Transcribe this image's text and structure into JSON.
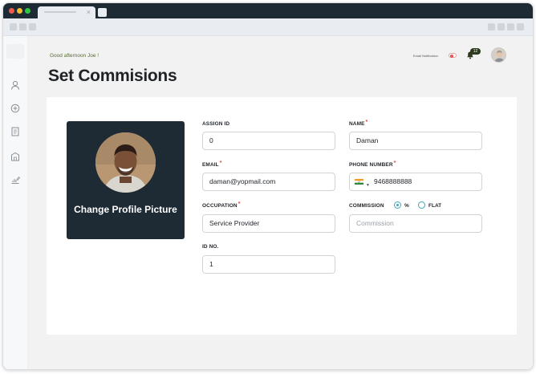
{
  "browser": {
    "tab_close": "×"
  },
  "header": {
    "greeting": "Good afternoon Joe !",
    "email_notification_label": "Email Notification",
    "notification_count": "12"
  },
  "page": {
    "title": "Set Commisions"
  },
  "profile": {
    "change_picture_label": "Change Profile Picture"
  },
  "form": {
    "assign_id": {
      "label": "ASSIGN ID",
      "value": "0"
    },
    "name": {
      "label": "NAME",
      "value": "Daman",
      "required": true
    },
    "email": {
      "label": "EMAIL",
      "value": "daman@yopmail.com",
      "required": true
    },
    "phone_number": {
      "label": "PHONE NUMBER",
      "value": "9468888888",
      "required": true,
      "country_flag": "india-flag-icon"
    },
    "occupation": {
      "label": "OCCUPATION",
      "value": "Service Provider",
      "required": true
    },
    "commission": {
      "label": "COMMISSION",
      "options": [
        "%",
        "FLAT"
      ],
      "selected": "%",
      "placeholder": "Commission"
    },
    "id_no": {
      "label": "ID NO.",
      "value": "1"
    }
  },
  "sidebar": {
    "icons": [
      "user-icon",
      "add-circle-icon",
      "document-list-icon",
      "building-icon",
      "chart-edit-icon"
    ]
  },
  "colors": {
    "dark_panel": "#1e2b35",
    "accent_teal": "#3aa8b8",
    "required_red": "#e04848",
    "greeting_green": "#556b2f"
  }
}
